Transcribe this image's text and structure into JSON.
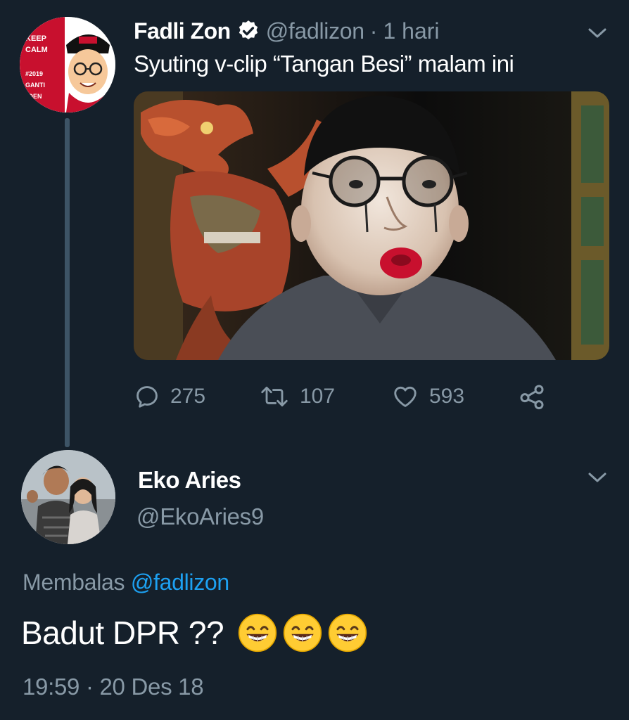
{
  "tweet": {
    "author_name": "Fadli Zon",
    "author_handle": "@fadlizon",
    "separator": "·",
    "time_ago": "1 hari",
    "text": "Syuting v-clip “Tangan Besi” malam ini",
    "avatar_text": [
      "KEEP",
      "CALM",
      "#2019",
      "GANTI",
      "IDEN"
    ],
    "media_icon": "photo-selfie",
    "stats": {
      "replies": "275",
      "retweets": "107",
      "likes": "593"
    }
  },
  "reply": {
    "author_name": "Eko Aries",
    "author_handle": "@EkoAries9",
    "replying_label": "Membalas",
    "replying_to": "@fadlizon",
    "text": "Badut DPR ??",
    "emojis": [
      "grinning-face-with-smiling-eyes",
      "grinning-face-with-smiling-eyes",
      "grinning-face-with-smiling-eyes"
    ],
    "timestamp": "19:59 · 20 Des 18"
  },
  "colors": {
    "background": "#15202b",
    "secondary_text": "#8899a6",
    "link": "#1da1f2",
    "thread_line": "#3d5466"
  }
}
